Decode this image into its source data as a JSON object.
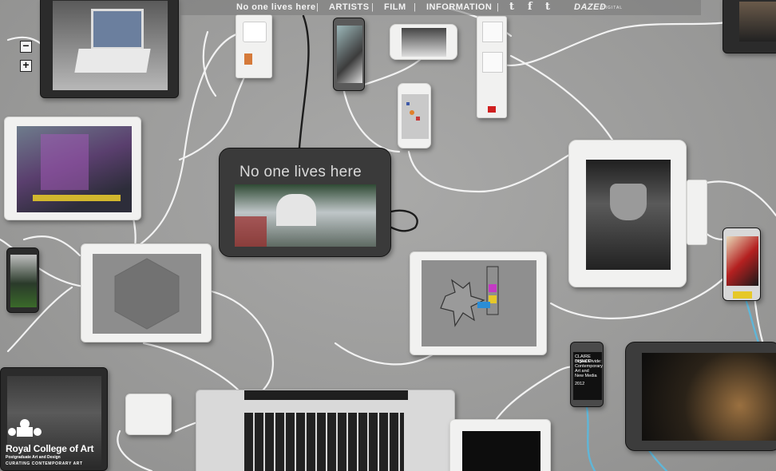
{
  "nav": {
    "title": "No one lives here",
    "artists": "ARTISTS",
    "film": "FILM",
    "information": "INFORMATION",
    "separator": "|",
    "social": [
      "t",
      "f",
      "t"
    ],
    "dazed": "DAZED",
    "dazed_sub": "DIGITAL"
  },
  "zoom": {
    "in": "+",
    "out": "−"
  },
  "featured_tablet": {
    "title": "No one lives here"
  },
  "phone_text": {
    "line1": "CLAIRE BISHOP",
    "line2": "Digital Divide:",
    "line3": "Contemporary",
    "line4": "Art and",
    "line5": "New Media",
    "line6": "2012"
  },
  "rca": {
    "name": "Royal College of Art",
    "sub": "Postgraduate Art and Design",
    "curating": "CURATING CONTEMPORARY ART"
  },
  "icons": [
    "zoom-in-icon",
    "zoom-out-icon",
    "twitter-icon",
    "facebook-icon",
    "tumblr-icon",
    "rca-crest-icon"
  ]
}
